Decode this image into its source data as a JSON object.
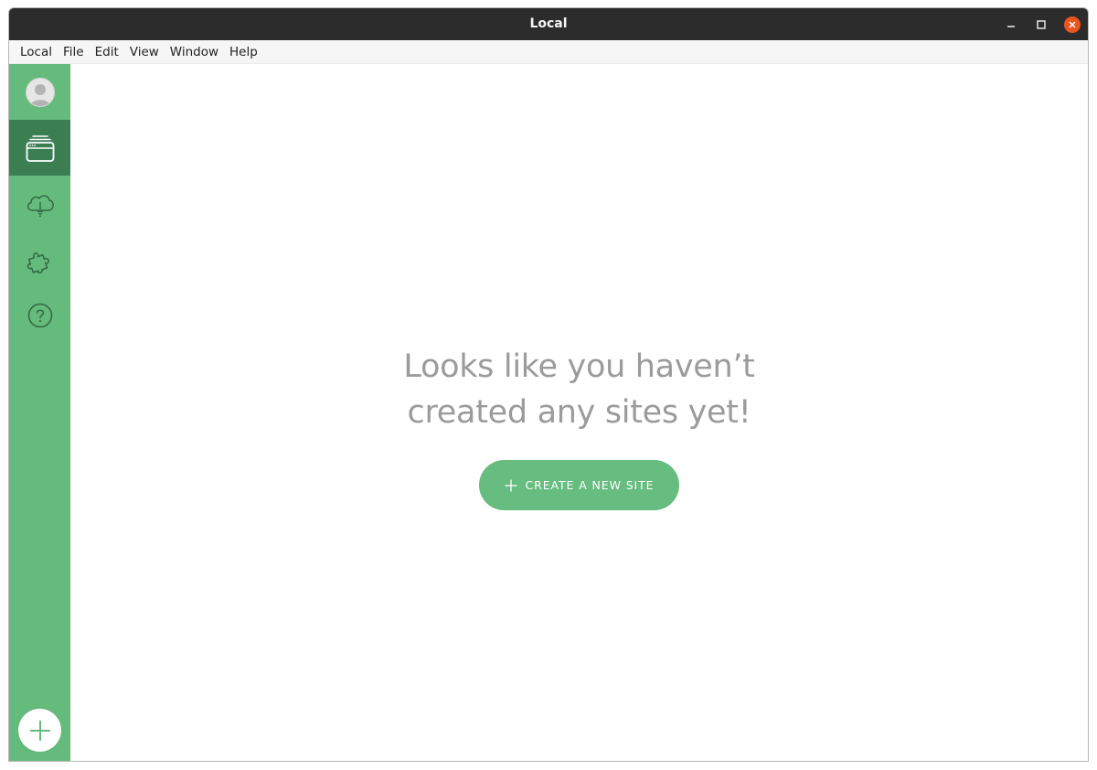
{
  "window": {
    "title": "Local"
  },
  "menubar": {
    "items": [
      "Local",
      "File",
      "Edit",
      "View",
      "Window",
      "Help"
    ]
  },
  "sidebar": {
    "items": [
      {
        "icon": "avatar-icon",
        "active": false
      },
      {
        "icon": "sites-stack-icon",
        "active": true
      },
      {
        "icon": "cloud-icon",
        "active": false
      },
      {
        "icon": "puzzle-addons-icon",
        "active": false
      },
      {
        "icon": "help-icon",
        "active": false
      }
    ],
    "add_icon": "plus-icon",
    "background_color": "#65bb7b",
    "active_color": "#3b7e52"
  },
  "main": {
    "empty_heading_line1": "Looks like you haven’t",
    "empty_heading_line2": "created any sites yet!",
    "create_button_label": "CREATE A NEW SITE",
    "create_button_icon": "plus-icon",
    "accent_color": "#67bc7f"
  }
}
